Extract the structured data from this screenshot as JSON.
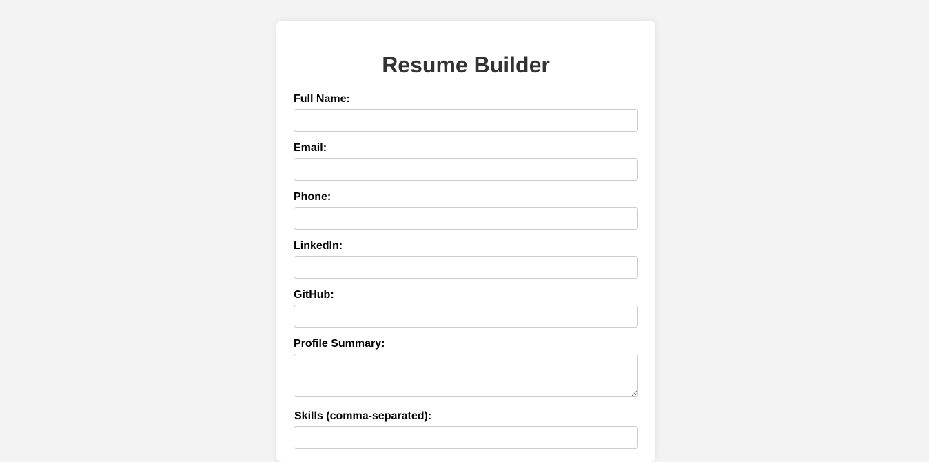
{
  "form": {
    "title": "Resume Builder",
    "fields": [
      {
        "label": "Full Name:",
        "value": ""
      },
      {
        "label": "Email:",
        "value": ""
      },
      {
        "label": "Phone:",
        "value": ""
      },
      {
        "label": "LinkedIn:",
        "value": ""
      },
      {
        "label": "GitHub:",
        "value": ""
      },
      {
        "label": "Profile Summary:",
        "value": ""
      },
      {
        "label": "Skills (comma-separated):",
        "value": ""
      }
    ]
  },
  "colors": {
    "page_background": "#f3f3f3",
    "card_background": "#ffffff",
    "title_color": "#333333",
    "input_border": "#cccccc"
  }
}
